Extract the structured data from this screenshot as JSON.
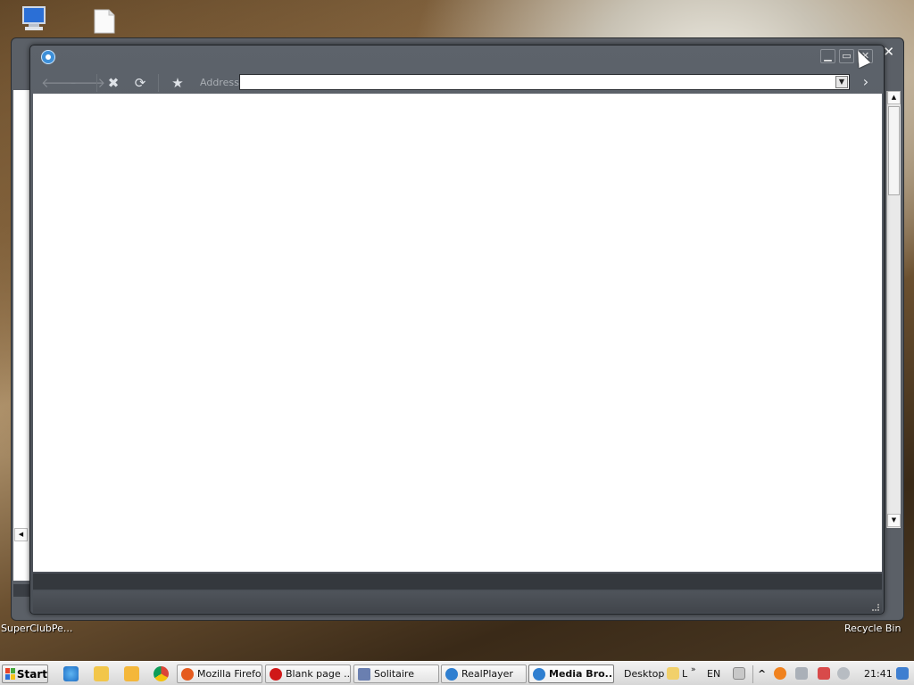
{
  "desktop": {
    "icons": [
      {
        "label": "SuperClubPe..."
      },
      {
        "label": "Recycle Bin"
      }
    ]
  },
  "browser": {
    "toolbar": {
      "address_label": "Address",
      "address_value": ""
    }
  },
  "taskbar": {
    "start_label": "Start",
    "tasks": [
      {
        "label": "Mozilla Firefox",
        "color": "#e55b1f"
      },
      {
        "label": "Blank page ...",
        "color": "#d01818"
      },
      {
        "label": "Solitaire",
        "color": "#6a7fb0"
      },
      {
        "label": "RealPlayer",
        "color": "#2f7fd0"
      },
      {
        "label": "Media Bro...",
        "color": "#2f7fd0"
      }
    ],
    "desktop_label": "Desktop",
    "lang": "EN",
    "clock": "21:41"
  },
  "colors": {
    "window_frame": "#4f545b",
    "taskbar": "#e4e4e4",
    "accent": "#3d8fd8"
  }
}
